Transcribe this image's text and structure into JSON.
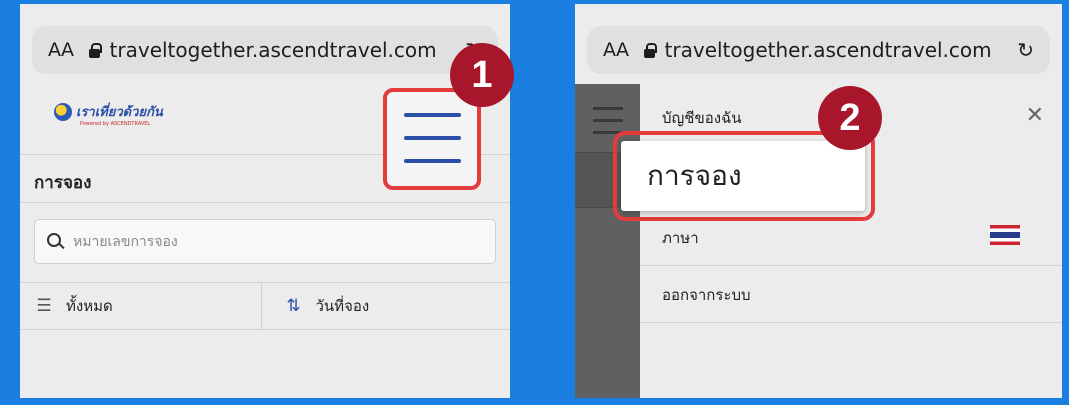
{
  "left_screen": {
    "address_bar": {
      "aa_label": "AA",
      "url": "traveltogether.ascendtravel.com",
      "reload_icon": "reload-icon"
    },
    "logo": {
      "text": "เราเที่ยวด้วยกัน",
      "powered_by": "Powered by ASCENDTRAVEL"
    },
    "page_title": "การจอง",
    "search": {
      "placeholder": "หมายเลขการจอง"
    },
    "filters": {
      "all_label": "ทั้งหมด",
      "sort_label": "วันที่จอง"
    },
    "step_badge": "1"
  },
  "right_screen": {
    "address_bar": {
      "aa_label": "AA",
      "url": "traveltogether.ascendtravel.com",
      "reload_icon": "reload-icon"
    },
    "menu": {
      "account_label": "บัญชีของฉัน",
      "bookings_label": "การจอง",
      "language_label": "ภาษา",
      "logout_label": "ออกจากระบบ"
    },
    "step_badge": "2"
  },
  "colors": {
    "background": "#1a7de0",
    "highlight": "#e23c3c",
    "badge": "#a8162c",
    "brand": "#2a4ea8"
  }
}
